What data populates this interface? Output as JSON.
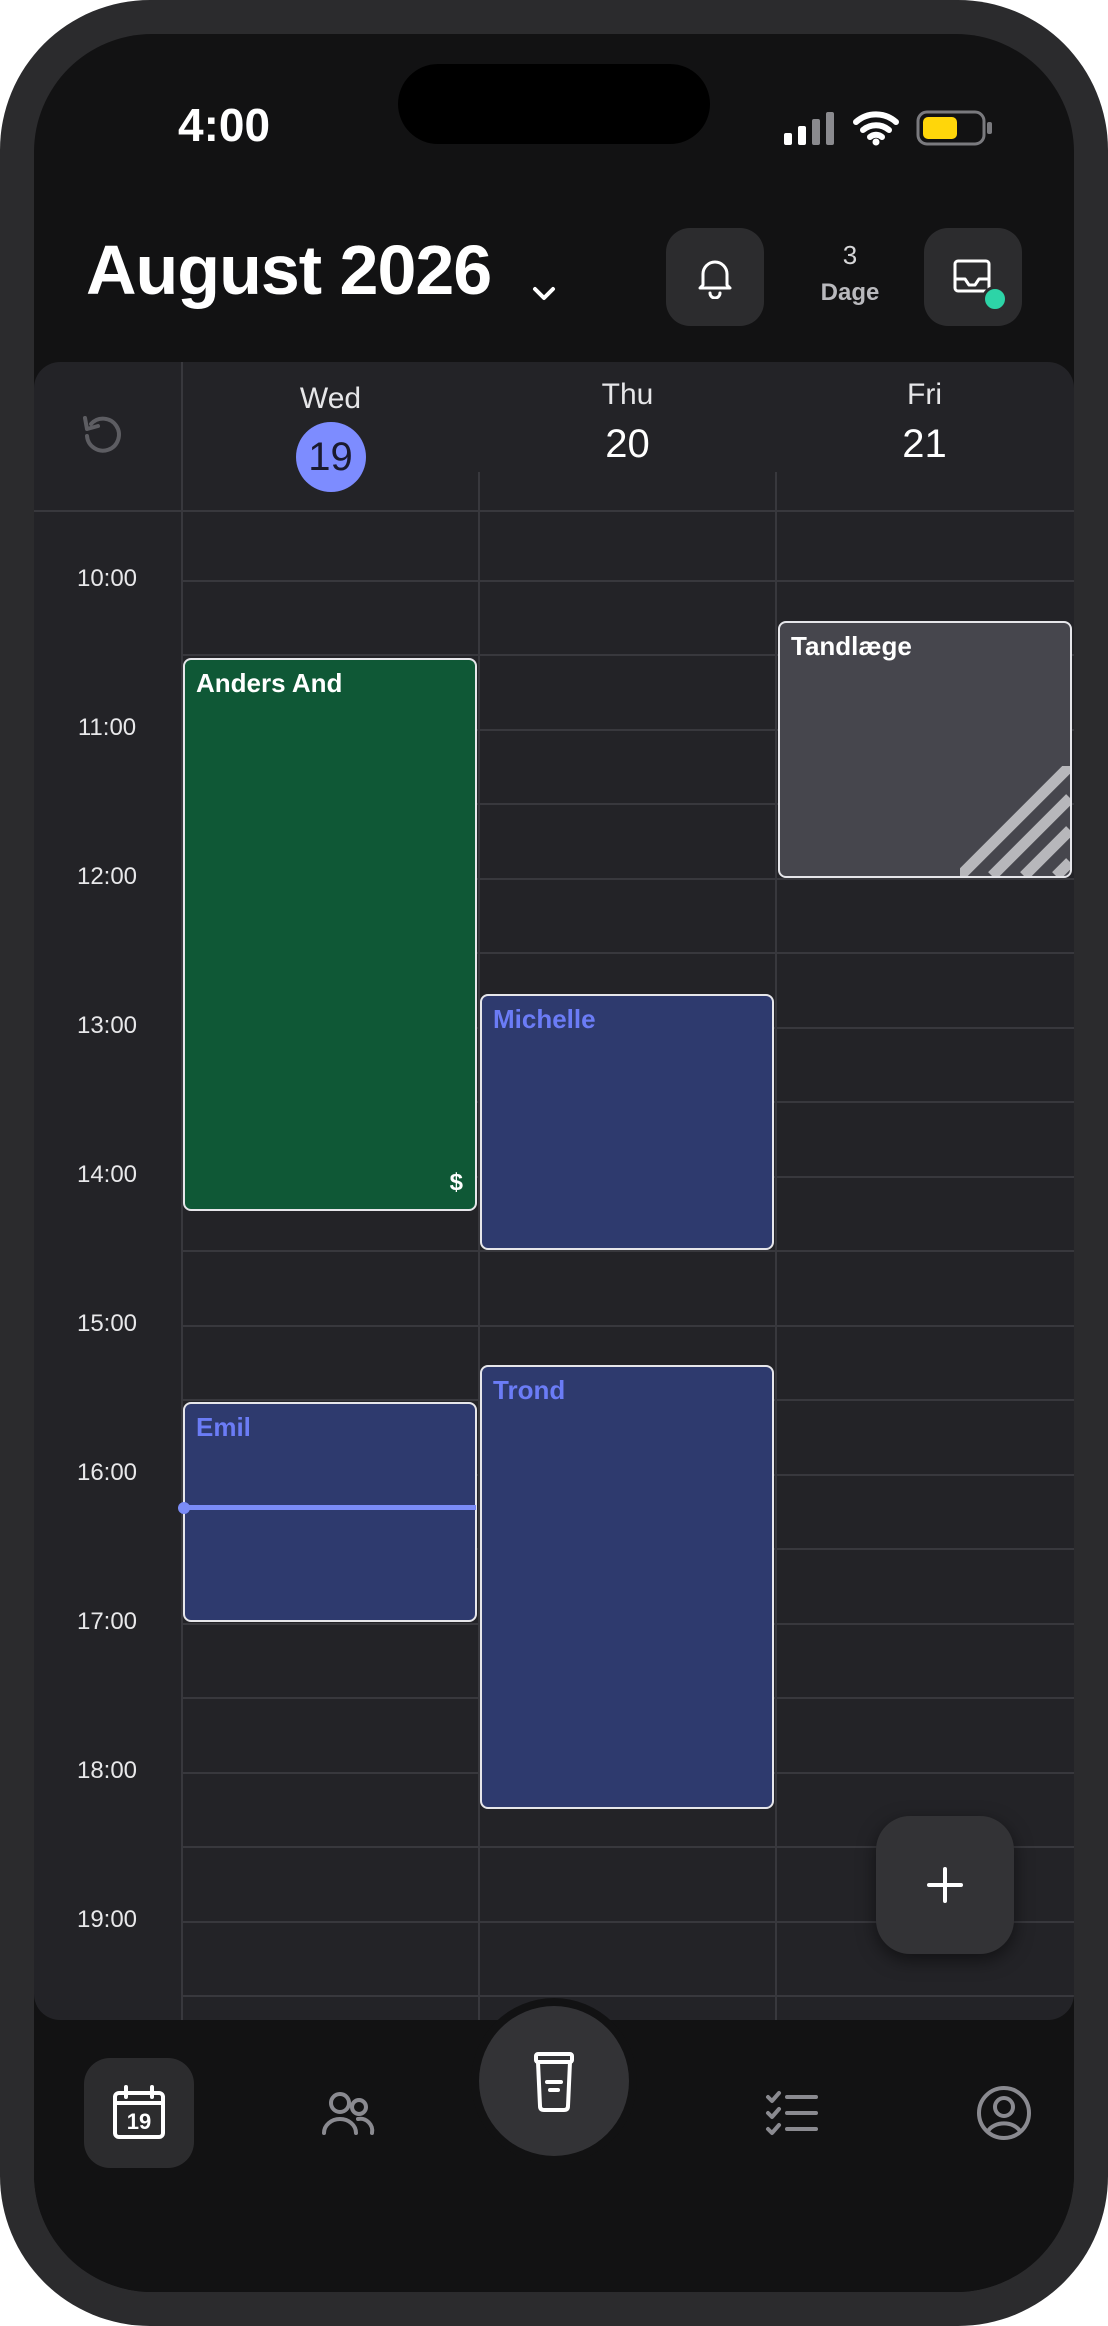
{
  "status_bar": {
    "time": "4:00",
    "icons": [
      "signal-icon",
      "wifi-icon",
      "battery-icon"
    ],
    "battery_color": "#ffd60a"
  },
  "header": {
    "title": "August 2026",
    "view_days_count": "3",
    "view_days_label": "Dage",
    "icons": [
      "chevron-down-icon",
      "bell-icon",
      "inbox-icon"
    ],
    "inbox_badge_color": "#2dd4a7"
  },
  "calendar": {
    "days": [
      {
        "name": "Wed",
        "date": "19",
        "today": true
      },
      {
        "name": "Thu",
        "date": "20",
        "today": false
      },
      {
        "name": "Fri",
        "date": "21",
        "today": false
      }
    ],
    "hours": [
      "10:00",
      "11:00",
      "12:00",
      "13:00",
      "14:00",
      "15:00",
      "16:00",
      "17:00",
      "18:00",
      "19:00"
    ],
    "current_time": "16:00",
    "accent_color": "#7d8cff",
    "events": [
      {
        "title": "Anders And",
        "day": "Wed",
        "start": "10:15",
        "end": "14:00",
        "color": "#0f5836",
        "badge": "$"
      },
      {
        "title": "Emil",
        "day": "Wed",
        "start": "15:15",
        "end": "16:45",
        "color": "#2e3a6e"
      },
      {
        "title": "Michelle",
        "day": "Thu",
        "start": "12:30",
        "end": "14:15",
        "color": "#2e3a6e"
      },
      {
        "title": "Trond",
        "day": "Thu",
        "start": "15:00",
        "end": "18:00",
        "color": "#2e3a6e"
      },
      {
        "title": "Tandlæge",
        "day": "Fri",
        "start": "10:00",
        "end": "11:45",
        "color": "#46464d"
      }
    ]
  },
  "fab": {
    "icon": "plus-icon"
  },
  "tabbar": {
    "items": [
      {
        "icon": "calendar-icon",
        "label": "19",
        "active": true
      },
      {
        "icon": "people-icon"
      },
      {
        "icon": "cup-icon"
      },
      {
        "icon": "checklist-icon"
      },
      {
        "icon": "profile-icon"
      }
    ]
  }
}
